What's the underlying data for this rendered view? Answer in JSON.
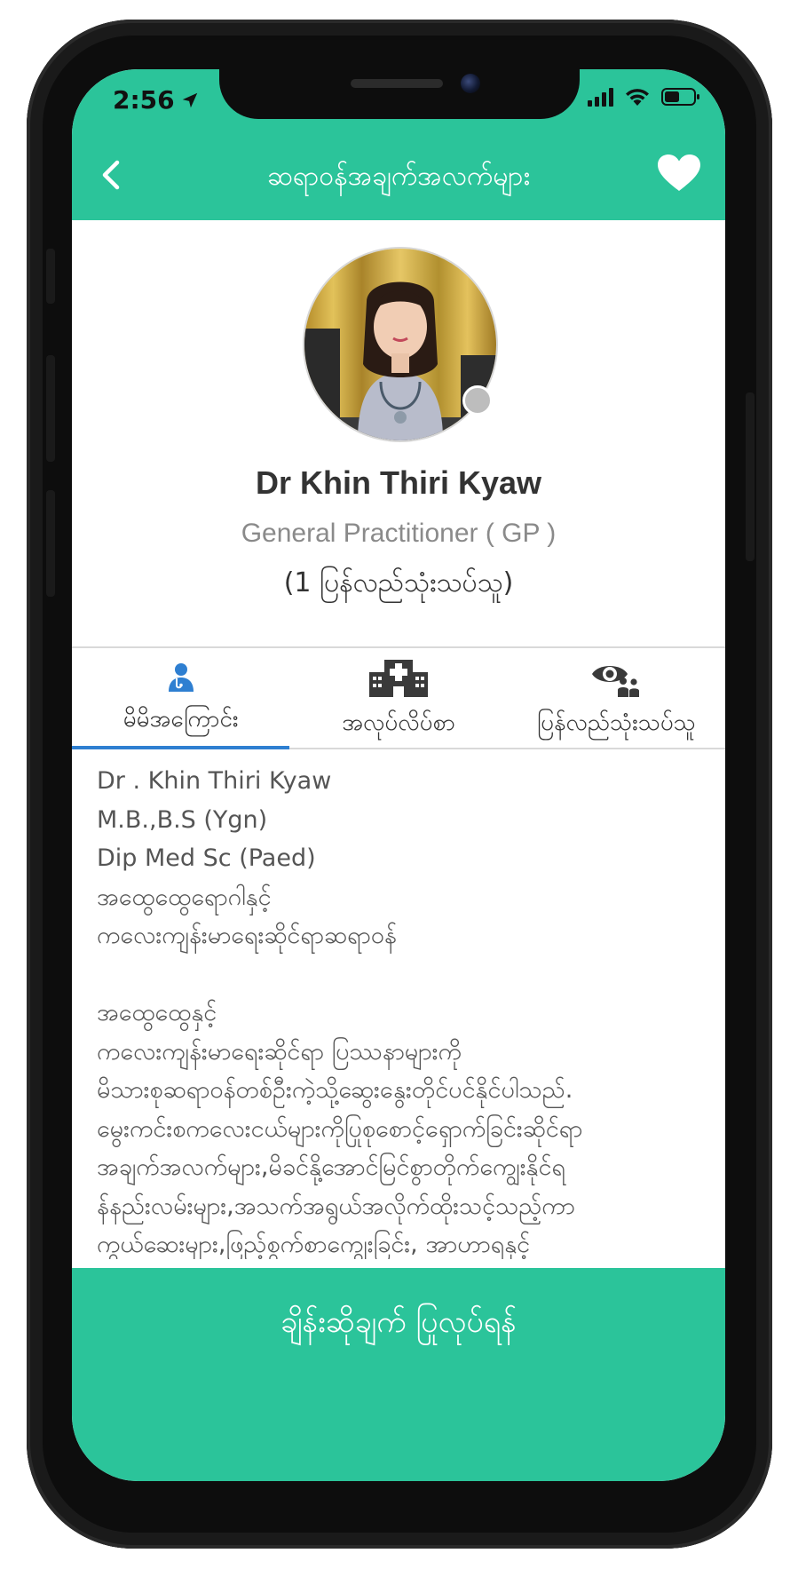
{
  "status_bar": {
    "time": "2:56",
    "icons": [
      "location-arrow-icon",
      "cellular-signal-icon",
      "wifi-icon",
      "battery-icon"
    ]
  },
  "header": {
    "title": "ဆရာဝန်အချက်အလက်များ",
    "back_icon": "chevron-left-icon",
    "favorite_icon": "heart-icon"
  },
  "profile": {
    "name": "Dr Khin Thiri Kyaw",
    "specialty": "General Practitioner ( GP )",
    "review_count": "(1 ပြန်လည်သုံးသပ်သူ)"
  },
  "tabs": [
    {
      "label": "မိမိအကြောင်း",
      "icon": "doctor-icon",
      "active": true
    },
    {
      "label": "အလုပ်လိပ်စာ",
      "icon": "hospital-icon",
      "active": false
    },
    {
      "label": "ပြန်လည်သုံးသပ်သူ",
      "icon": "reviewers-icon",
      "active": false
    }
  ],
  "bio": {
    "lines": [
      "Dr . Khin Thiri Kyaw",
      "M.B.,B.S (Ygn)",
      "Dip Med Sc (Paed)",
      "အထွေထွေရောဂါနှင့်",
      "ကလေးကျန်းမာရေးဆိုင်ရာဆရာဝန်",
      "",
      "အထွေထွေနှင့်",
      "ကလေးကျန်းမာရေးဆိုင်ရာ ပြဿနာများကို",
      "မိသားစုဆရာဝန်တစ်ဦးကဲ့သို့ဆွေးနွေးတိုင်ပင်နိုင်ပါသည်.",
      "မွေးကင်းစကလေးငယ်များကိုပြုစုစောင့်ရှောက်ခြင်းဆိုင်ရာ",
      "အချက်အလက်များ,မိခင်နို့အောင်မြင်စွာတိုက်ကျွေးနိုင်ရ",
      "န်နည်းလမ်းများ,အသက်အရွယ်အလိုက်ထိုးသင့်သည့်ကာ",
      "ကွယ်ဆေးများ,ဖြည့်စွက်စာကျွေးခြင်း, အာဟာရနှင့်"
    ]
  },
  "cta": {
    "label": "ချိန်းဆိုချက် ပြုလုပ်ရန်"
  },
  "colors": {
    "brand": "#2bc49a",
    "tab_indicator": "#2e7fd1",
    "doctor_icon": "#2e7fd1",
    "text_dark": "#333333",
    "text_muted": "#8a8a8a"
  }
}
